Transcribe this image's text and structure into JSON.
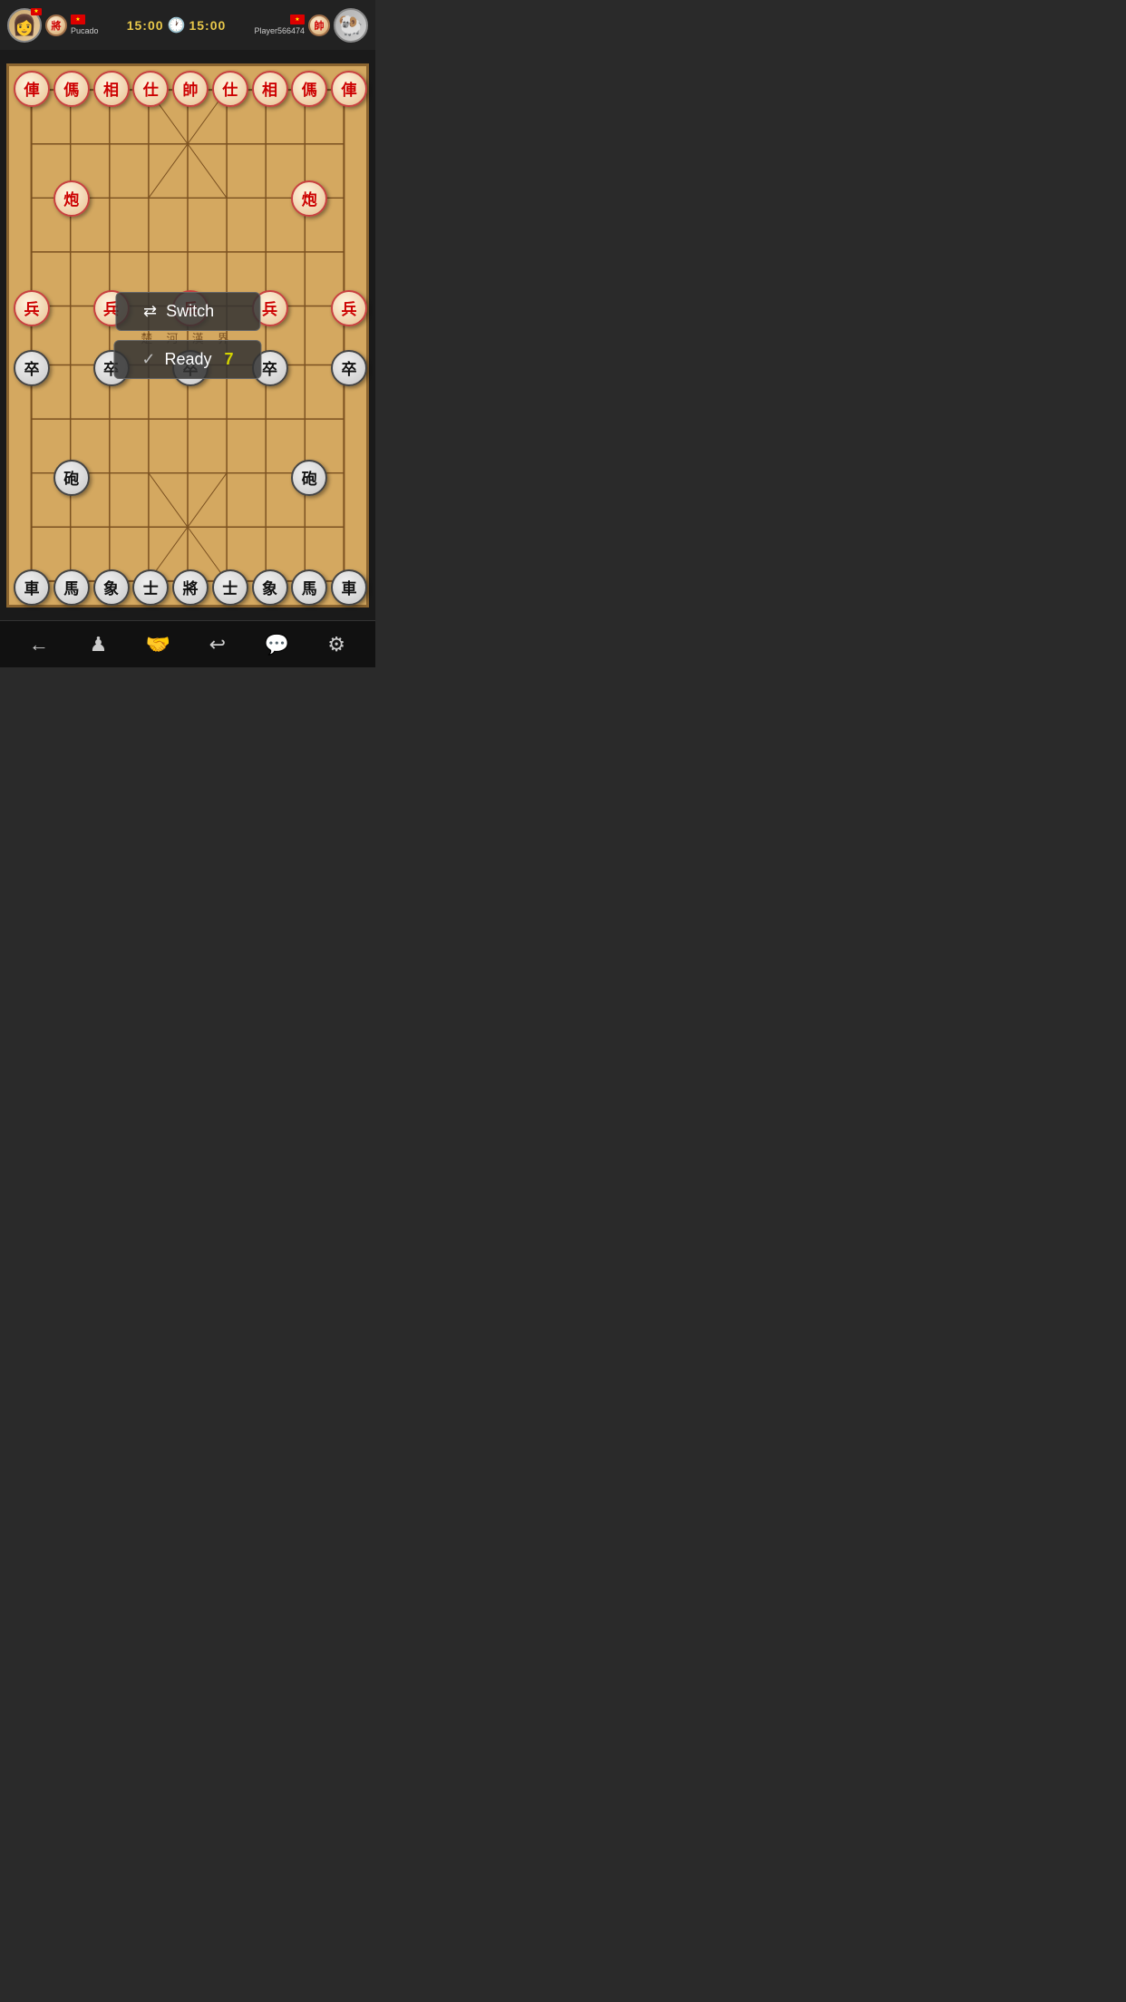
{
  "header": {
    "player_left": {
      "name": "Pucado",
      "avatar_emoji": "👩",
      "piece_label": "將",
      "timer": "15:00",
      "flag_color": "#dd0000",
      "flag_star": "★"
    },
    "player_right": {
      "name": "Player566474",
      "avatar_emoji": "🐏",
      "piece_label": "帥",
      "timer": "15:00",
      "flag_color": "#dd0000",
      "flag_star": "★"
    },
    "timer_icon": "🕐"
  },
  "board": {
    "cols": 9,
    "rows": 10,
    "red_pieces": [
      {
        "char": "俥",
        "col": 0,
        "row": 0
      },
      {
        "char": "傌",
        "col": 1,
        "row": 0
      },
      {
        "char": "相",
        "col": 2,
        "row": 0
      },
      {
        "char": "仕",
        "col": 3,
        "row": 0
      },
      {
        "char": "帥",
        "col": 4,
        "row": 0
      },
      {
        "char": "仕",
        "col": 5,
        "row": 0
      },
      {
        "char": "相",
        "col": 6,
        "row": 0
      },
      {
        "char": "傌",
        "col": 7,
        "row": 0
      },
      {
        "char": "俥",
        "col": 8,
        "row": 0
      },
      {
        "char": "炮",
        "col": 1,
        "row": 2
      },
      {
        "char": "炮",
        "col": 7,
        "row": 2
      },
      {
        "char": "兵",
        "col": 0,
        "row": 4
      },
      {
        "char": "兵",
        "col": 2,
        "row": 4
      },
      {
        "char": "兵",
        "col": 4,
        "row": 4
      },
      {
        "char": "兵",
        "col": 6,
        "row": 4
      },
      {
        "char": "兵",
        "col": 8,
        "row": 4
      }
    ],
    "black_pieces": [
      {
        "char": "車",
        "col": 0,
        "row": 9
      },
      {
        "char": "馬",
        "col": 1,
        "row": 9
      },
      {
        "char": "象",
        "col": 2,
        "row": 9
      },
      {
        "char": "士",
        "col": 3,
        "row": 9
      },
      {
        "char": "將",
        "col": 4,
        "row": 9
      },
      {
        "char": "士",
        "col": 5,
        "row": 9
      },
      {
        "char": "象",
        "col": 6,
        "row": 9
      },
      {
        "char": "馬",
        "col": 7,
        "row": 9
      },
      {
        "char": "車",
        "col": 8,
        "row": 9
      },
      {
        "char": "砲",
        "col": 1,
        "row": 7
      },
      {
        "char": "砲",
        "col": 7,
        "row": 7
      },
      {
        "char": "卒",
        "col": 0,
        "row": 5
      },
      {
        "char": "卒",
        "col": 2,
        "row": 5
      },
      {
        "char": "卒",
        "col": 4,
        "row": 5
      },
      {
        "char": "卒",
        "col": 6,
        "row": 5
      },
      {
        "char": "卒",
        "col": 8,
        "row": 5
      }
    ]
  },
  "overlay": {
    "switch_label": "Switch",
    "ready_label": "Ready",
    "ready_count": "7"
  },
  "toolbar": {
    "buttons": [
      {
        "name": "back",
        "icon": "←"
      },
      {
        "name": "move",
        "icon": "♟"
      },
      {
        "name": "handshake",
        "icon": "🤝"
      },
      {
        "name": "undo",
        "icon": "↩"
      },
      {
        "name": "chat",
        "icon": "💬"
      },
      {
        "name": "settings",
        "icon": "⚙"
      }
    ]
  }
}
